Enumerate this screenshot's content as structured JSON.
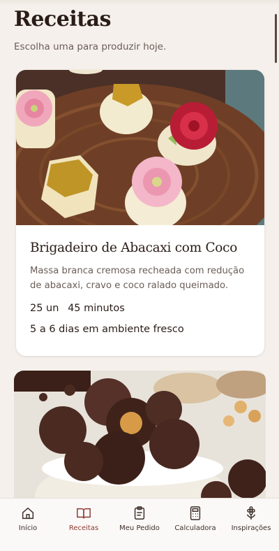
{
  "header": {
    "title": "Receitas",
    "subtitle": "Escolha uma para produzir hoje."
  },
  "recipe_card": {
    "title": "Brigadeiro de Abacaxi com Coco",
    "description": "Massa branca cremosa recheada com redução de abacaxi, cravo e coco ralado queimado.",
    "yield": "25 un",
    "time": "45 minutos",
    "shelf_life": "5 a 6 dias em ambiente fresco"
  },
  "bottom_nav": {
    "active": "Receitas",
    "accent_color": "#8c3a34",
    "items": [
      {
        "label": "Início",
        "icon": "home-icon"
      },
      {
        "label": "Receitas",
        "icon": "book-icon"
      },
      {
        "label": "Meu Pedido",
        "icon": "clipboard-icon"
      },
      {
        "label": "Calculadora",
        "icon": "calculator-icon"
      },
      {
        "label": "Inspirações",
        "icon": "flower-icon"
      }
    ]
  }
}
